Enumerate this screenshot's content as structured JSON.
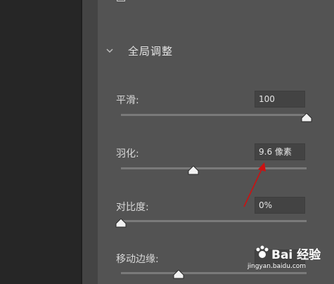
{
  "top_option": {
    "label": ""
  },
  "section": {
    "title": "全局调整"
  },
  "controls": [
    {
      "label": "平滑:",
      "value": "100"
    },
    {
      "label": "羽化:",
      "value": "9.6 像素"
    },
    {
      "label": "对比度:",
      "value": "0%"
    },
    {
      "label": "移动边缘:",
      "value": ""
    }
  ],
  "colors": {
    "annotation_arrow": "#cc1111",
    "panel_bg": "#535353"
  },
  "watermark": {
    "brand": "Bai 经验",
    "url": "jingyan.baidu.com"
  }
}
